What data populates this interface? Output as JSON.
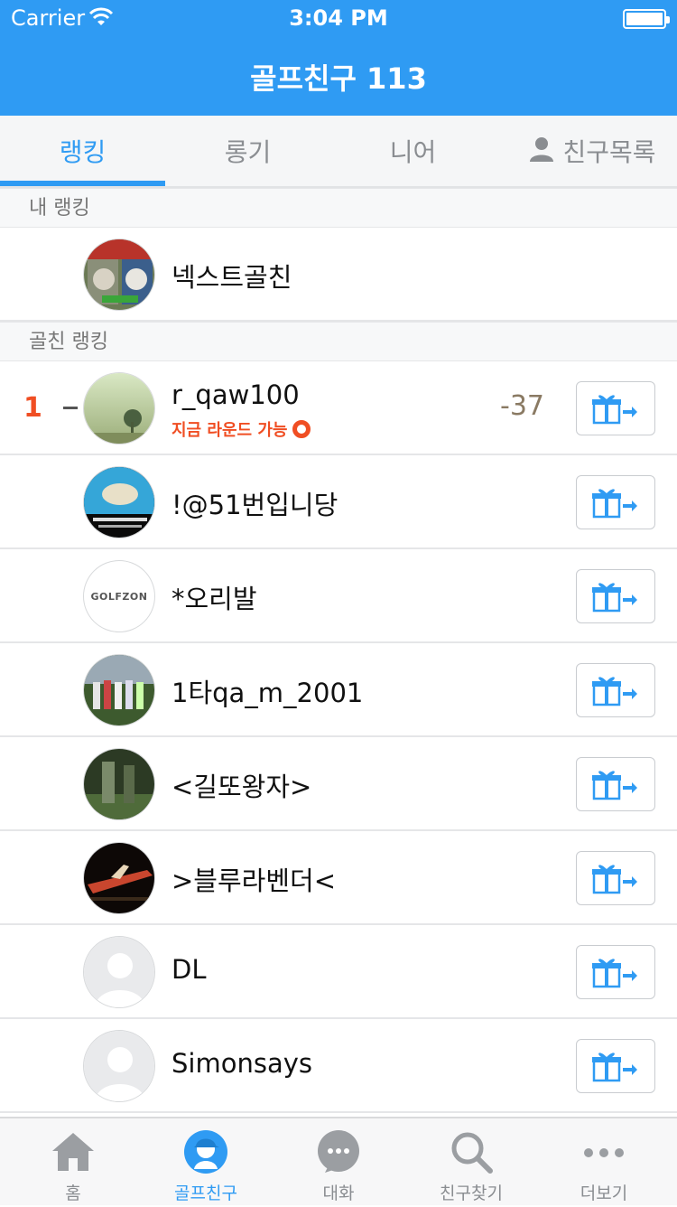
{
  "status_bar": {
    "carrier": "Carrier",
    "time": "3:04 PM"
  },
  "header": {
    "title": "골프친구 113"
  },
  "tabs": [
    {
      "label": "랭킹",
      "active": true
    },
    {
      "label": "롱기",
      "active": false
    },
    {
      "label": "니어",
      "active": false
    },
    {
      "label": "친구목록",
      "active": false
    }
  ],
  "sections": {
    "my_ranking": "내 랭킹",
    "friend_ranking": "골친 랭킹"
  },
  "my_row": {
    "name": "넥스트골친"
  },
  "friends": [
    {
      "rank": "1",
      "name": "r_qaw100",
      "status": "지금 라운드 가능",
      "score": "-37"
    },
    {
      "name": "!@51번입니당"
    },
    {
      "name": "*오리발",
      "avatar_text": "GOLFZON"
    },
    {
      "name": "1타qa_m_2001"
    },
    {
      "name": "<길또왕자>"
    },
    {
      "name": ">블루라벤더<"
    },
    {
      "name": "DL"
    },
    {
      "name": "Simonsays"
    }
  ],
  "tabbar": [
    {
      "label": "홈",
      "icon": "home-icon",
      "active": false
    },
    {
      "label": "골프친구",
      "icon": "golf-friend-icon",
      "active": true
    },
    {
      "label": "대화",
      "icon": "chat-icon",
      "active": false
    },
    {
      "label": "친구찾기",
      "icon": "search-icon",
      "active": false
    },
    {
      "label": "더보기",
      "icon": "more-icon",
      "active": false
    }
  ],
  "colors": {
    "accent": "#2f9bf3",
    "rank": "#f04e23",
    "score": "#8a7a63"
  }
}
